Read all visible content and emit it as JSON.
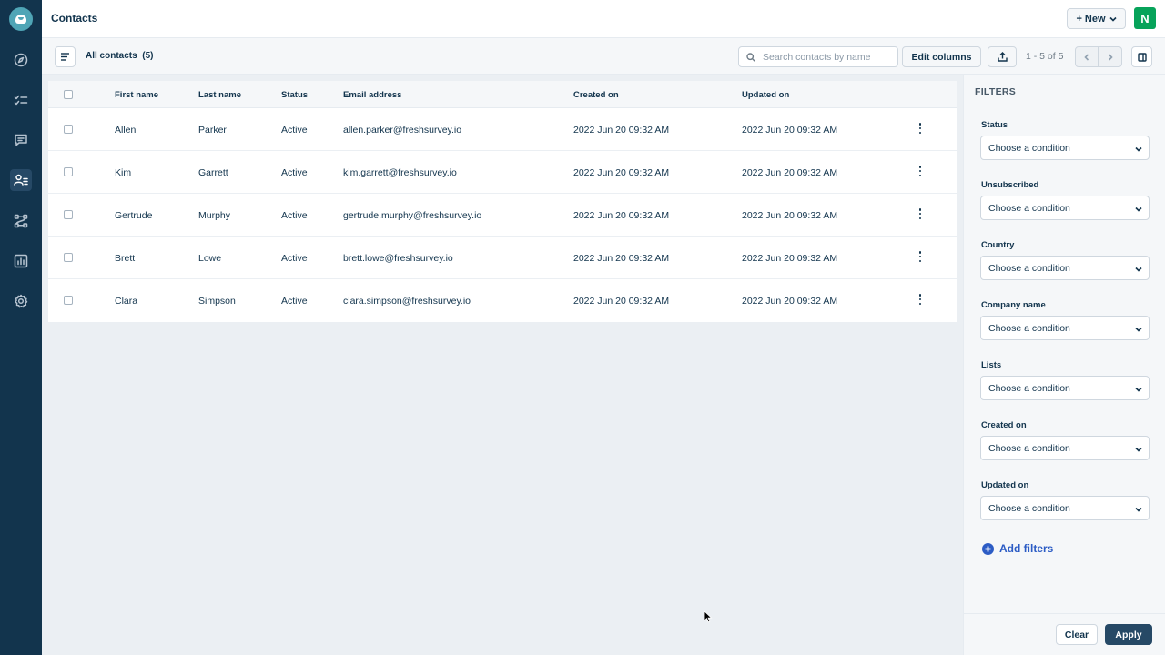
{
  "header": {
    "title": "Contacts",
    "new_label": "+ New",
    "avatar_initial": "N"
  },
  "sidebar": {
    "items": [
      {
        "icon": "compass-icon"
      },
      {
        "icon": "checklist-icon"
      },
      {
        "icon": "message-icon"
      },
      {
        "icon": "contacts-icon",
        "active": true
      },
      {
        "icon": "workflow-icon"
      },
      {
        "icon": "chart-icon"
      },
      {
        "icon": "settings-icon"
      }
    ]
  },
  "toolbar": {
    "view_title": "All contacts  (5)",
    "search_placeholder": "Search contacts by name",
    "edit_columns": "Edit columns",
    "pagination": "1 - 5 of 5"
  },
  "table": {
    "columns": [
      "First name",
      "Last name",
      "Status",
      "Email address",
      "Created on",
      "Updated on"
    ],
    "rows": [
      {
        "first": "Allen",
        "last": "Parker",
        "status": "Active",
        "email": "allen.parker@freshsurvey.io",
        "created": "2022 Jun 20 09:32 AM",
        "updated": "2022 Jun 20 09:32 AM"
      },
      {
        "first": "Kim",
        "last": "Garrett",
        "status": "Active",
        "email": "kim.garrett@freshsurvey.io",
        "created": "2022 Jun 20 09:32 AM",
        "updated": "2022 Jun 20 09:32 AM"
      },
      {
        "first": "Gertrude",
        "last": "Murphy",
        "status": "Active",
        "email": "gertrude.murphy@freshsurvey.io",
        "created": "2022 Jun 20 09:32 AM",
        "updated": "2022 Jun 20 09:32 AM"
      },
      {
        "first": "Brett",
        "last": "Lowe",
        "status": "Active",
        "email": "brett.lowe@freshsurvey.io",
        "created": "2022 Jun 20 09:32 AM",
        "updated": "2022 Jun 20 09:32 AM"
      },
      {
        "first": "Clara",
        "last": "Simpson",
        "status": "Active",
        "email": "clara.simpson@freshsurvey.io",
        "created": "2022 Jun 20 09:32 AM",
        "updated": "2022 Jun 20 09:32 AM"
      }
    ]
  },
  "filters": {
    "title": "FILTERS",
    "fields": [
      {
        "label": "Status",
        "value": "Choose a condition"
      },
      {
        "label": "Unsubscribed",
        "value": "Choose a condition"
      },
      {
        "label": "Country",
        "value": "Choose a condition"
      },
      {
        "label": "Company name",
        "value": "Choose a condition"
      },
      {
        "label": "Lists",
        "value": "Choose a condition"
      },
      {
        "label": "Created on",
        "value": "Choose a condition"
      },
      {
        "label": "Updated on",
        "value": "Choose a condition"
      }
    ],
    "add_label": "Add filters",
    "clear_label": "Clear",
    "apply_label": "Apply"
  },
  "colors": {
    "nav_bg": "#12344d",
    "accent_blue": "#2c5cc5",
    "avatar_green": "#07a35a",
    "apply_bg": "#264966"
  }
}
